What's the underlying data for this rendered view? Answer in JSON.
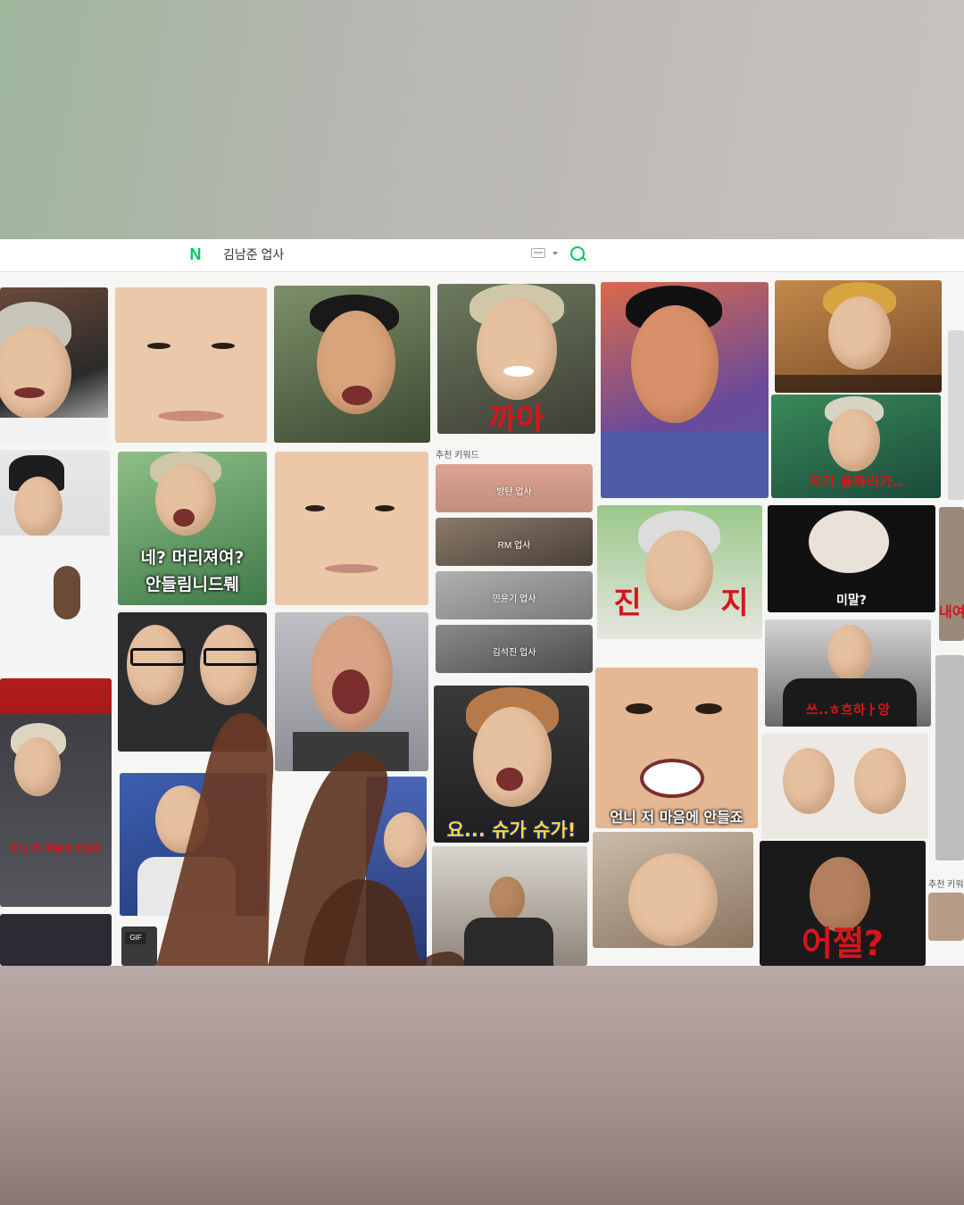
{
  "search": {
    "logo": "N",
    "query": "김남준 업사"
  },
  "captions": {
    "kka_a": "까아",
    "ne_meori": "네? 머리져여?",
    "an_deullim": "안들림니드뤠",
    "jeogi": "저기 을짜리가..",
    "jin": "진",
    "ji": "지",
    "mimal": "미말?",
    "neo": "내여",
    "sseu": "쓰..ㅎ흐하ㅏ앙",
    "yo_suga": "요... 슈가 슈가!",
    "eonni": "언니 저 마음에 안들죠",
    "eojjeol": "어쩔?",
    "gif": "GIF"
  },
  "keywords": {
    "label": "추천 키워드",
    "items": [
      "방탄 업사",
      "RM 업사",
      "민윤기 업사",
      "김석진 업사"
    ]
  },
  "sidebar": {
    "keyword_label": "추천 키워드"
  },
  "colors": {
    "naver_green": "#03c75a",
    "caption_red": "#d8141b",
    "caption_white": "#ffffff"
  }
}
